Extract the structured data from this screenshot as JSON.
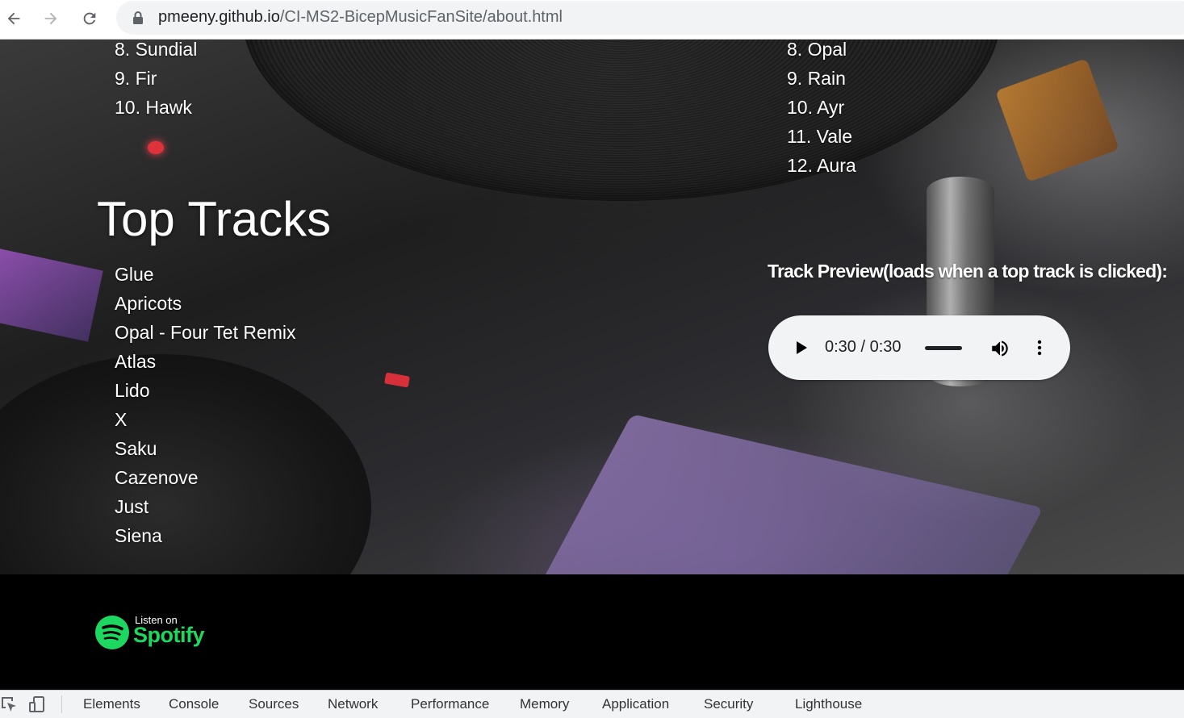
{
  "browser": {
    "url_domain": "pmeeny.github.io",
    "url_path": "/CI-MS2-BicepMusicFanSite/about.html"
  },
  "albums": {
    "left_list": [
      "8. Sundial",
      "9. Fir",
      "10. Hawk"
    ],
    "right_list": [
      "8. Opal",
      "9. Rain",
      "10. Ayr",
      "11. Vale",
      "12. Aura"
    ]
  },
  "top_tracks": {
    "heading": "Top Tracks",
    "items": [
      "Glue",
      "Apricots",
      "Opal - Four Tet Remix",
      "Atlas",
      "Lido",
      "X",
      "Saku",
      "Cazenove",
      "Just",
      "Siena"
    ]
  },
  "preview": {
    "label": "Track Preview(loads when a top track is clicked):",
    "time": "0:30 / 0:30"
  },
  "footer": {
    "spotify_small": "Listen on",
    "spotify_word": "Spotify"
  },
  "devtools": {
    "tabs": [
      "Elements",
      "Console",
      "Sources",
      "Network",
      "Performance",
      "Memory",
      "Application",
      "Security",
      "Lighthouse"
    ]
  },
  "colors": {
    "spotify_green": "#1ed760",
    "page_background": "#000000",
    "player_background": "#f1f3f4"
  },
  "icons": [
    "back-arrow-icon",
    "forward-arrow-icon",
    "reload-icon",
    "lock-icon",
    "play-icon",
    "volume-icon",
    "more-vert-icon",
    "spotify-logo-icon",
    "inspect-element-icon",
    "device-toolbar-icon"
  ]
}
